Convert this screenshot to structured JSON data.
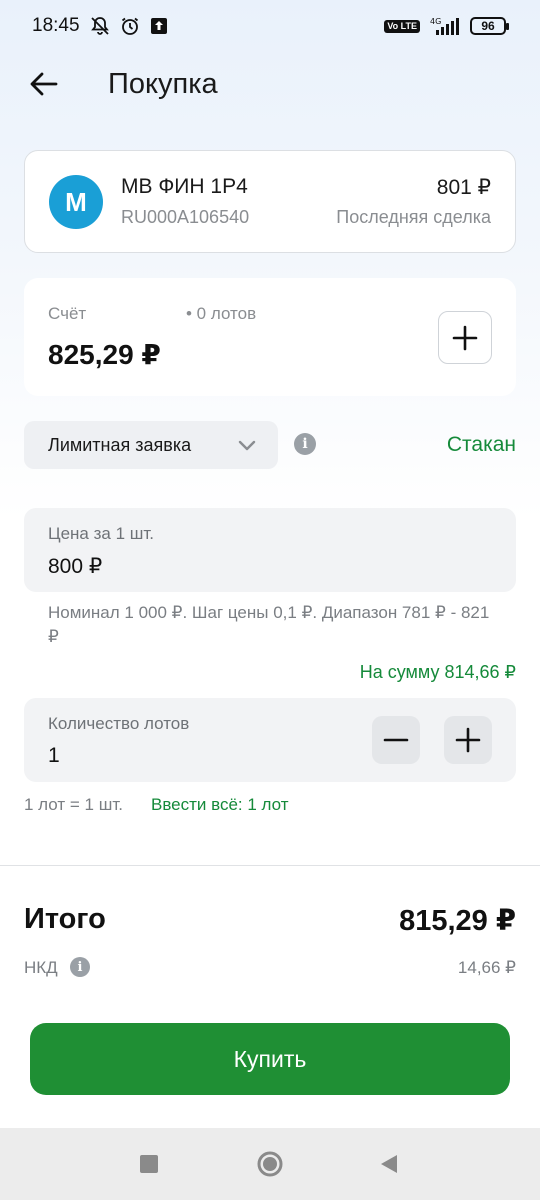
{
  "status_bar": {
    "time": "18:45",
    "network": "4G",
    "volte": "Vo LTE",
    "battery": "96"
  },
  "header": {
    "title": "Покупка"
  },
  "bond": {
    "avatar_letter": "M",
    "name": "МВ ФИН 1Р4",
    "isin": "RU000A106540",
    "price": "801 ₽",
    "price_label": "Последняя сделка"
  },
  "account": {
    "label": "Счёт",
    "lots": "• 0 лотов",
    "balance": "825,29 ₽"
  },
  "order": {
    "type_label": "Лимитная заявка",
    "orderbook_link": "Стакан"
  },
  "price_field": {
    "label": "Цена за 1 шт.",
    "value": "800 ₽",
    "hint": "Номинал 1 000 ₽. Шаг цены 0,1 ₽. Диапазон 781 ₽ - 821 ₽",
    "sum": "На сумму 814,66 ₽"
  },
  "qty_field": {
    "label": "Количество лотов",
    "value": "1",
    "lot_hint": "1 лот = 1 шт.",
    "enter_all": "Ввести всё: 1 лот"
  },
  "totals": {
    "total_label": "Итого",
    "total_value": "815,29 ₽",
    "nkd_label": "НКД",
    "nkd_value": "14,66 ₽"
  },
  "actions": {
    "buy_label": "Купить"
  },
  "colors": {
    "accent_green": "#1f8f34",
    "link_green": "#158a3a",
    "avatar_blue": "#1a9fd6"
  }
}
